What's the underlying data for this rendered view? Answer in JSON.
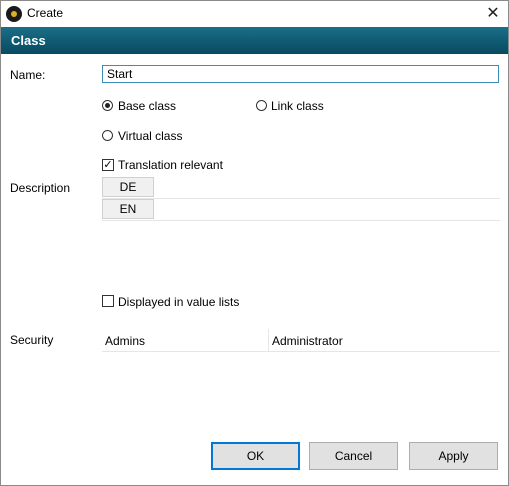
{
  "window": {
    "title": "Create",
    "close_glyph": "✕"
  },
  "banner": {
    "title": "Class"
  },
  "form": {
    "name_label": "Name:",
    "name_value": "Start",
    "radios": [
      {
        "label": "Base class",
        "checked": true
      },
      {
        "label": "Link class",
        "checked": false
      },
      {
        "label": "Virtual class",
        "checked": false
      }
    ],
    "translation_relevant": {
      "label": "Translation relevant",
      "checked": true,
      "mark": "✓"
    },
    "description_label": "Description",
    "languages": [
      {
        "code": "DE",
        "value": ""
      },
      {
        "code": "EN",
        "value": ""
      }
    ],
    "displayed_in_value_lists": {
      "label": "Displayed in value lists",
      "checked": false
    },
    "security_label": "Security",
    "security": {
      "group": "Admins",
      "user": "Administrator"
    }
  },
  "buttons": {
    "ok": "OK",
    "cancel": "Cancel",
    "apply": "Apply"
  },
  "colors": {
    "banner": "#0e5870",
    "accent": "#0078d7"
  }
}
